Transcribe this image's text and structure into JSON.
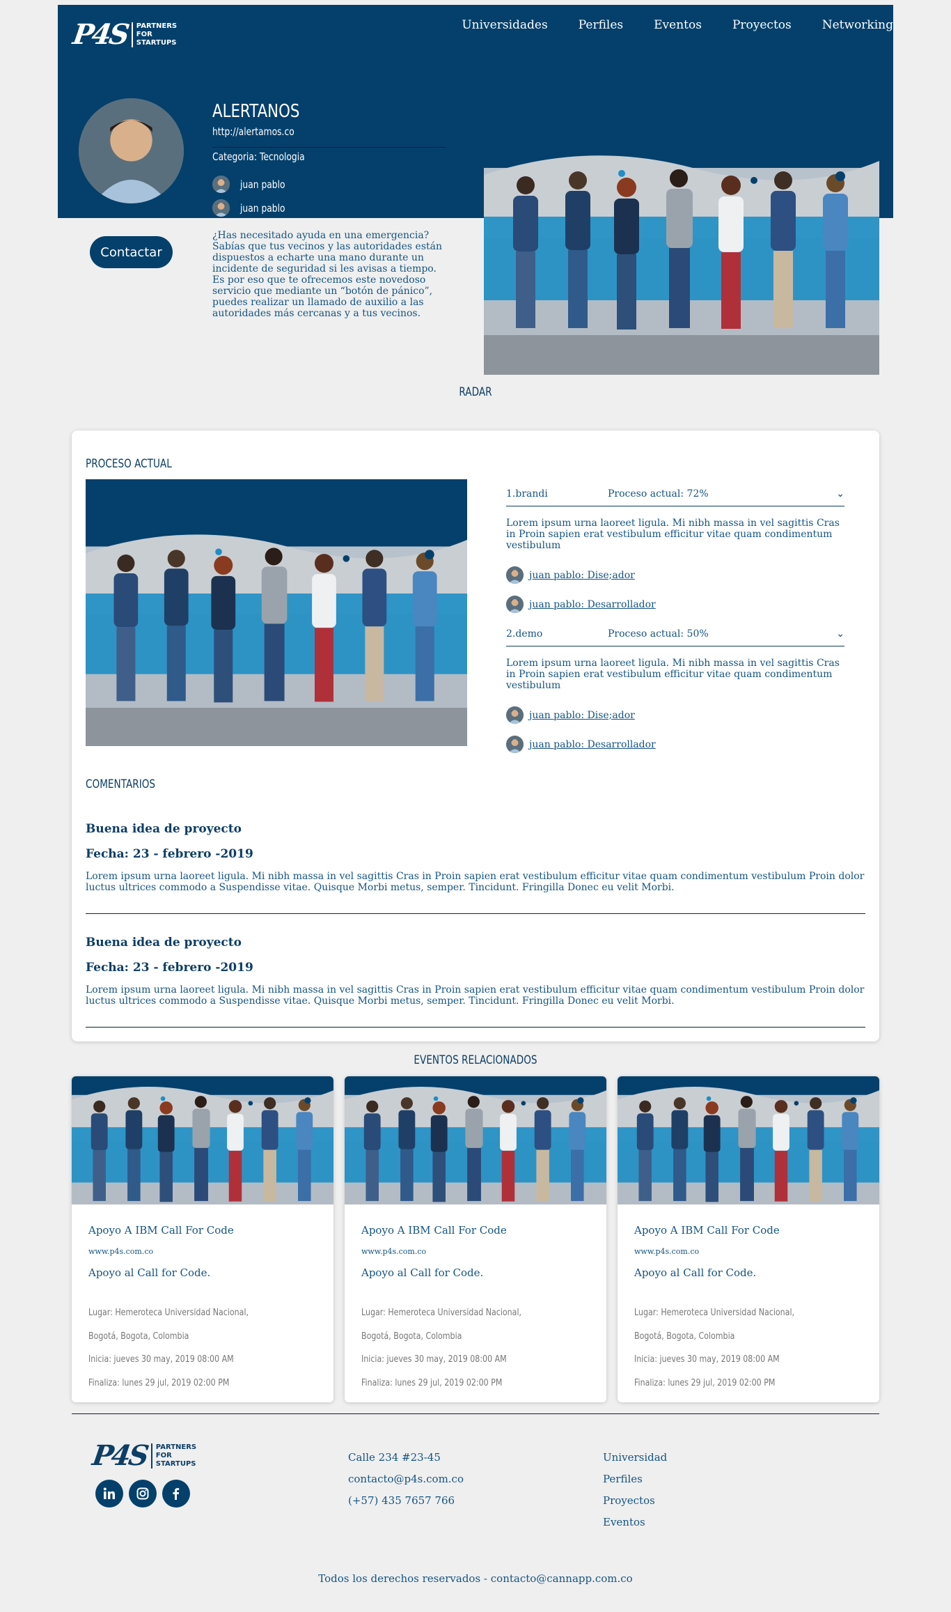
{
  "header": {
    "logo_mark": "P4S",
    "logo_text_1": "PARTNERS",
    "logo_text_2": "FOR",
    "logo_text_3": "STARTUPS",
    "nav": [
      "Universidades",
      "Perfiles",
      "Eventos",
      "Proyectos",
      "Networking"
    ]
  },
  "company": {
    "title": "ALERTANOS",
    "url": "http://alertamos.co",
    "category": "Categoria: Tecnologia",
    "members": [
      "juan pablo",
      "juan pablo"
    ],
    "contact_button": "Contactar",
    "description": "¿Has necesitado ayuda en una emergencia? Sabías que tus vecinos y las autoridades están dispuestos a echarte una mano durante un incidente de seguridad si les avisas a tiempo. Es por eso que te ofrecemos este novedoso servicio que mediante un “botón de pánico”, puedes realizar un llamado de auxilio a las autoridades más cercanas y a tus vecinos."
  },
  "radar_heading": "RADAR",
  "process": {
    "heading": "PROCESO ACTUAL",
    "items": [
      {
        "name": "1.brandi",
        "progress": "Proceso actual: 72%",
        "description": "Lorem ipsum urna laoreet ligula. Mi nibh massa in vel sagittis Cras in Proin sapien erat vestibulum efficitur vitae quam condimentum vestibulum",
        "members": [
          "juan pablo: Dise;ador",
          "juan pablo: Desarrollador"
        ]
      },
      {
        "name": "2.demo",
        "progress": "Proceso actual: 50%",
        "description": "Lorem ipsum urna laoreet ligula. Mi nibh massa in vel sagittis Cras in Proin sapien erat vestibulum efficitur vitae quam condimentum vestibulum",
        "members": [
          "juan pablo: Dise;ador",
          "juan pablo: Desarrollador"
        ]
      }
    ]
  },
  "comments": {
    "heading": "COMENTARIOS",
    "items": [
      {
        "title": "Buena idea de proyecto",
        "date": "Fecha: 23 - febrero -2019",
        "body": "Lorem ipsum urna laoreet ligula. Mi nibh massa in vel sagittis Cras in Proin sapien erat vestibulum efficitur vitae quam condimentum vestibulum Proin dolor luctus ultrices commodo a Suspendisse vitae. Quisque Morbi metus, semper. Tincidunt. Fringilla Donec eu velit Morbi."
      },
      {
        "title": "Buena idea de proyecto",
        "date": "Fecha: 23 - febrero -2019",
        "body": "Lorem ipsum urna laoreet ligula. Mi nibh massa in vel sagittis Cras in Proin sapien erat vestibulum efficitur vitae quam condimentum vestibulum Proin dolor luctus ultrices commodo a Suspendisse vitae. Quisque Morbi metus, semper. Tincidunt. Fringilla Donec eu velit Morbi."
      }
    ]
  },
  "events": {
    "heading": "EVENTOS RELACIONADOS",
    "items": [
      {
        "title": "Apoyo A IBM Call For Code",
        "url": "www.p4s.com.co",
        "description": "Apoyo al Call for Code.",
        "place": "Lugar: Hemeroteca Universidad Nacional,",
        "city": "Bogotá, Bogota, Colombia",
        "start": "Inicia: jueves 30 may, 2019 08:00 AM",
        "end": "Finaliza: lunes 29 jul, 2019 02:00 PM"
      },
      {
        "title": "Apoyo A IBM Call For Code",
        "url": "www.p4s.com.co",
        "description": "Apoyo al Call for Code.",
        "place": "Lugar: Hemeroteca Universidad Nacional,",
        "city": "Bogotá, Bogota, Colombia",
        "start": "Inicia: jueves 30 may, 2019 08:00 AM",
        "end": "Finaliza: lunes 29 jul, 2019 02:00 PM"
      },
      {
        "title": "Apoyo A IBM Call For Code",
        "url": "www.p4s.com.co",
        "description": "Apoyo al Call for Code.",
        "place": "Lugar: Hemeroteca Universidad Nacional,",
        "city": "Bogotá, Bogota, Colombia",
        "start": "Inicia: jueves 30 may, 2019 08:00 AM",
        "end": "Finaliza: lunes 29 jul, 2019 02:00 PM"
      }
    ]
  },
  "footer": {
    "address": "Calle 234 #23-45",
    "email": "contacto@p4s.com.co",
    "phone": "(+57) 435 7657 766",
    "links": [
      "Universidad",
      "Perfiles",
      "Proyectos",
      "Eventos"
    ],
    "social": [
      "linkedin-icon",
      "instagram-icon",
      "facebook-icon"
    ],
    "copyright": "Todos los derechos reservados - contacto@cannapp.com.co"
  },
  "colors": {
    "primary": "#04406b",
    "accent_light": "#1e8ec4",
    "text": "#145482",
    "background": "#efefef"
  }
}
